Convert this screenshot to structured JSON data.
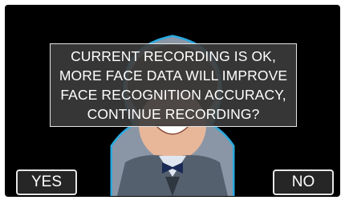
{
  "dialog": {
    "lines": [
      "CURRENT RECORDING IS OK,",
      "MORE FACE DATA WILL IMPROVE",
      "FACE RECOGNITION ACCURACY,",
      "CONTINUE RECORDING?"
    ]
  },
  "buttons": {
    "yes_label": "YES",
    "no_label": "NO"
  },
  "colors": {
    "screen_background": "#000000",
    "face_guide_outline": "#2aa9e0",
    "dialog_background": "#3c3c3c",
    "button_border": "#e6e6e6"
  }
}
